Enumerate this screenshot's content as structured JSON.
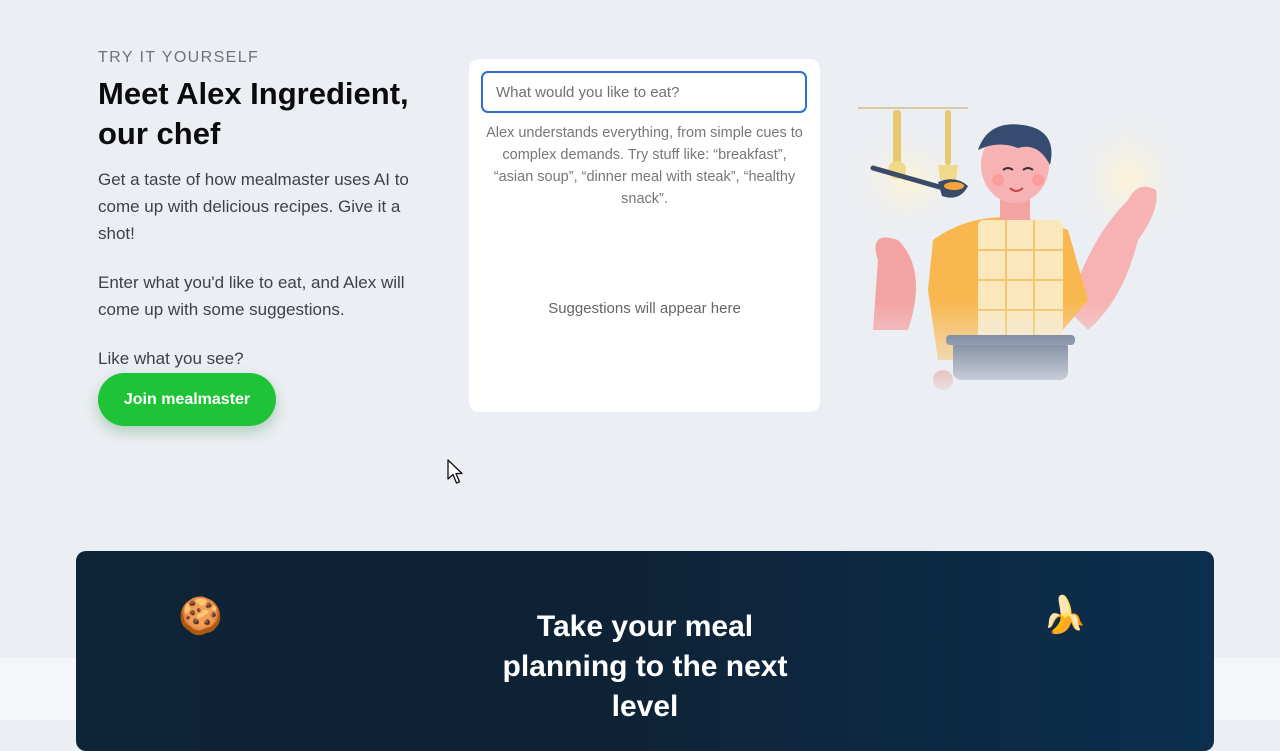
{
  "intro": {
    "eyebrow": "TRY IT YOURSELF",
    "headline_line1": "Meet Alex Ingredient,",
    "headline_line2": "our chef",
    "paragraph1": "Get a taste of how mealmaster uses AI to come up with delicious recipes. Give it a shot!",
    "paragraph2": "Enter what you'd like to eat, and Alex will come up with some suggestions.",
    "paragraph3": "Like what you see?",
    "join_label": "Join mealmaster"
  },
  "search": {
    "placeholder": "What would you like to eat?",
    "value": "",
    "hint": "Alex understands everything, from simple cues to complex demands. Try stuff like: “breakfast”, “asian soup”, “dinner meal with steak”, “healthy snack”.",
    "empty_state": "Suggestions will appear here"
  },
  "illustration": {
    "icon": "chef-illustration",
    "colors": {
      "shirt": "#f9b84f",
      "skin": "#f4a3a3",
      "hair": "#354b70",
      "pot": "#3a4a67"
    }
  },
  "cta": {
    "title_line1": "Take your meal",
    "title_line2": "planning to the next",
    "title_line3": "level",
    "left_icon": "🍪",
    "right_icon": "🍌"
  },
  "colors": {
    "brand_green": "#1fc337",
    "focus_blue": "#2f6fd1",
    "page_bg": "#ebeef3",
    "cta_bg": "#0e2437"
  }
}
